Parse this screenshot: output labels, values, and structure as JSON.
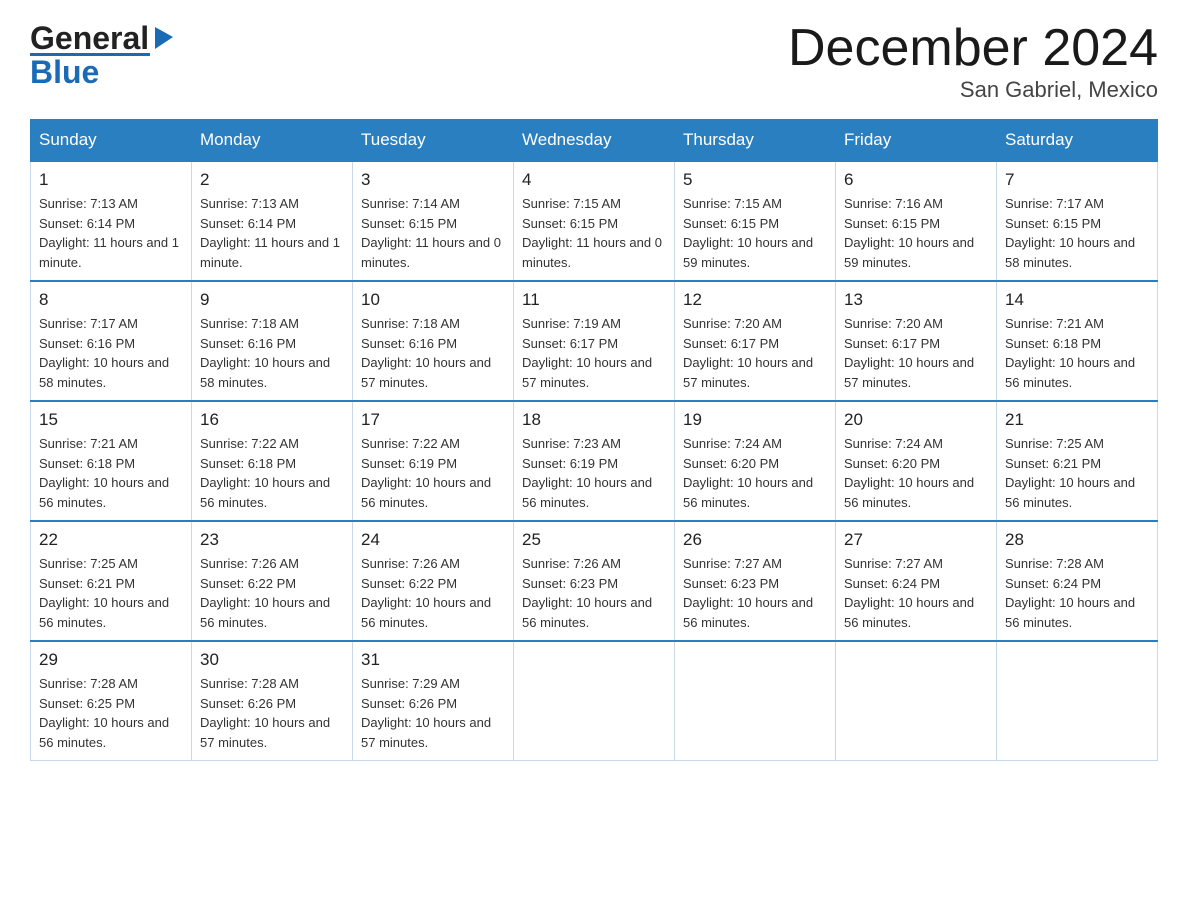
{
  "header": {
    "logo_general": "General",
    "logo_blue": "Blue",
    "month_title": "December 2024",
    "location": "San Gabriel, Mexico"
  },
  "days_of_week": [
    "Sunday",
    "Monday",
    "Tuesday",
    "Wednesday",
    "Thursday",
    "Friday",
    "Saturday"
  ],
  "weeks": [
    [
      {
        "day": "1",
        "sunrise": "7:13 AM",
        "sunset": "6:14 PM",
        "daylight": "11 hours and 1 minute."
      },
      {
        "day": "2",
        "sunrise": "7:13 AM",
        "sunset": "6:14 PM",
        "daylight": "11 hours and 1 minute."
      },
      {
        "day": "3",
        "sunrise": "7:14 AM",
        "sunset": "6:15 PM",
        "daylight": "11 hours and 0 minutes."
      },
      {
        "day": "4",
        "sunrise": "7:15 AM",
        "sunset": "6:15 PM",
        "daylight": "11 hours and 0 minutes."
      },
      {
        "day": "5",
        "sunrise": "7:15 AM",
        "sunset": "6:15 PM",
        "daylight": "10 hours and 59 minutes."
      },
      {
        "day": "6",
        "sunrise": "7:16 AM",
        "sunset": "6:15 PM",
        "daylight": "10 hours and 59 minutes."
      },
      {
        "day": "7",
        "sunrise": "7:17 AM",
        "sunset": "6:15 PM",
        "daylight": "10 hours and 58 minutes."
      }
    ],
    [
      {
        "day": "8",
        "sunrise": "7:17 AM",
        "sunset": "6:16 PM",
        "daylight": "10 hours and 58 minutes."
      },
      {
        "day": "9",
        "sunrise": "7:18 AM",
        "sunset": "6:16 PM",
        "daylight": "10 hours and 58 minutes."
      },
      {
        "day": "10",
        "sunrise": "7:18 AM",
        "sunset": "6:16 PM",
        "daylight": "10 hours and 57 minutes."
      },
      {
        "day": "11",
        "sunrise": "7:19 AM",
        "sunset": "6:17 PM",
        "daylight": "10 hours and 57 minutes."
      },
      {
        "day": "12",
        "sunrise": "7:20 AM",
        "sunset": "6:17 PM",
        "daylight": "10 hours and 57 minutes."
      },
      {
        "day": "13",
        "sunrise": "7:20 AM",
        "sunset": "6:17 PM",
        "daylight": "10 hours and 57 minutes."
      },
      {
        "day": "14",
        "sunrise": "7:21 AM",
        "sunset": "6:18 PM",
        "daylight": "10 hours and 56 minutes."
      }
    ],
    [
      {
        "day": "15",
        "sunrise": "7:21 AM",
        "sunset": "6:18 PM",
        "daylight": "10 hours and 56 minutes."
      },
      {
        "day": "16",
        "sunrise": "7:22 AM",
        "sunset": "6:18 PM",
        "daylight": "10 hours and 56 minutes."
      },
      {
        "day": "17",
        "sunrise": "7:22 AM",
        "sunset": "6:19 PM",
        "daylight": "10 hours and 56 minutes."
      },
      {
        "day": "18",
        "sunrise": "7:23 AM",
        "sunset": "6:19 PM",
        "daylight": "10 hours and 56 minutes."
      },
      {
        "day": "19",
        "sunrise": "7:24 AM",
        "sunset": "6:20 PM",
        "daylight": "10 hours and 56 minutes."
      },
      {
        "day": "20",
        "sunrise": "7:24 AM",
        "sunset": "6:20 PM",
        "daylight": "10 hours and 56 minutes."
      },
      {
        "day": "21",
        "sunrise": "7:25 AM",
        "sunset": "6:21 PM",
        "daylight": "10 hours and 56 minutes."
      }
    ],
    [
      {
        "day": "22",
        "sunrise": "7:25 AM",
        "sunset": "6:21 PM",
        "daylight": "10 hours and 56 minutes."
      },
      {
        "day": "23",
        "sunrise": "7:26 AM",
        "sunset": "6:22 PM",
        "daylight": "10 hours and 56 minutes."
      },
      {
        "day": "24",
        "sunrise": "7:26 AM",
        "sunset": "6:22 PM",
        "daylight": "10 hours and 56 minutes."
      },
      {
        "day": "25",
        "sunrise": "7:26 AM",
        "sunset": "6:23 PM",
        "daylight": "10 hours and 56 minutes."
      },
      {
        "day": "26",
        "sunrise": "7:27 AM",
        "sunset": "6:23 PM",
        "daylight": "10 hours and 56 minutes."
      },
      {
        "day": "27",
        "sunrise": "7:27 AM",
        "sunset": "6:24 PM",
        "daylight": "10 hours and 56 minutes."
      },
      {
        "day": "28",
        "sunrise": "7:28 AM",
        "sunset": "6:24 PM",
        "daylight": "10 hours and 56 minutes."
      }
    ],
    [
      {
        "day": "29",
        "sunrise": "7:28 AM",
        "sunset": "6:25 PM",
        "daylight": "10 hours and 56 minutes."
      },
      {
        "day": "30",
        "sunrise": "7:28 AM",
        "sunset": "6:26 PM",
        "daylight": "10 hours and 57 minutes."
      },
      {
        "day": "31",
        "sunrise": "7:29 AM",
        "sunset": "6:26 PM",
        "daylight": "10 hours and 57 minutes."
      },
      null,
      null,
      null,
      null
    ]
  ]
}
